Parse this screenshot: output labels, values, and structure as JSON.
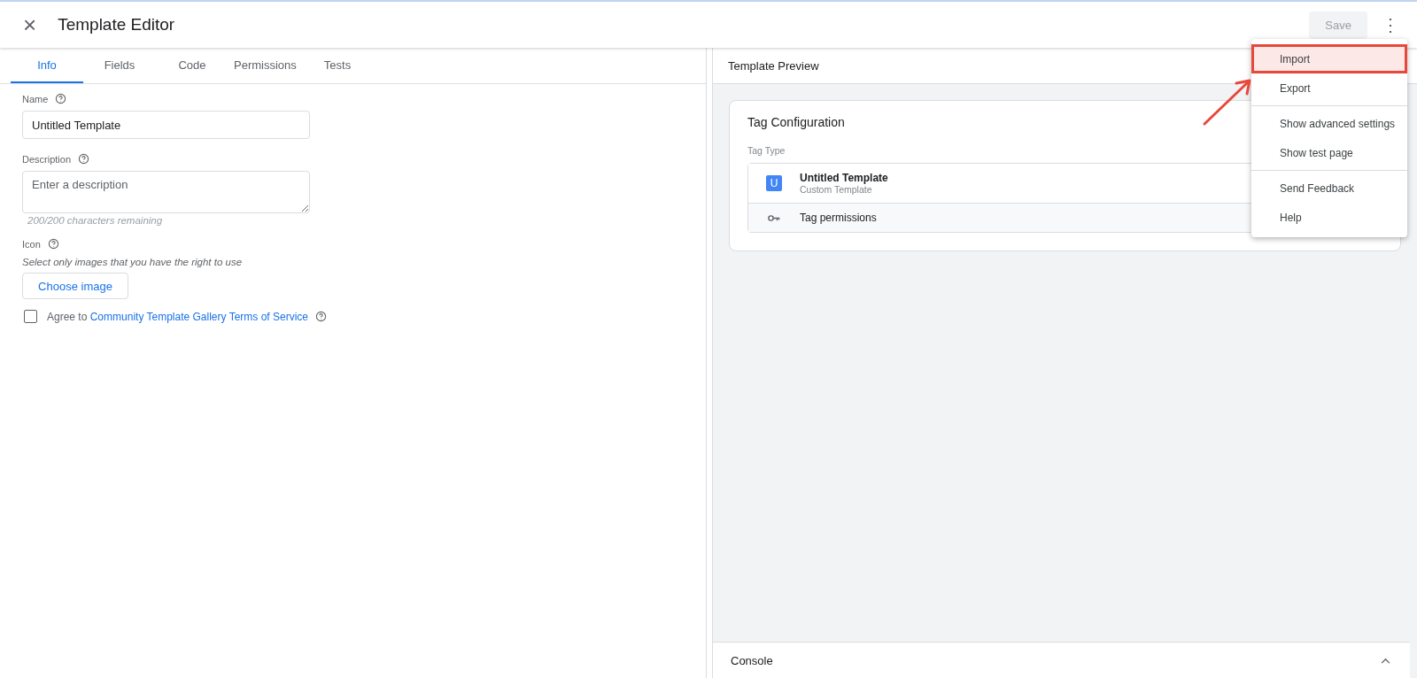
{
  "header": {
    "close": "×",
    "title": "Template Editor",
    "save": {
      "label": "Save",
      "disabled": true
    },
    "more": "⋮"
  },
  "tabs": [
    {
      "label": "Info",
      "selected": true
    },
    {
      "label": "Fields",
      "selected": false
    },
    {
      "label": "Code",
      "selected": false
    },
    {
      "label": "Permissions",
      "selected": false
    },
    {
      "label": "Tests",
      "selected": false
    }
  ],
  "form": {
    "name": {
      "label": "Name",
      "value": "Untitled Template"
    },
    "description": {
      "label": "Description",
      "placeholder": "Enter a description",
      "helper": "200/200 characters remaining"
    },
    "icon": {
      "label": "Icon",
      "note": "Select only images that you have the right to use",
      "button": "Choose image"
    },
    "agree": {
      "checked": false,
      "prefix": "Agree to",
      "link": "Community Template Gallery Terms of Service"
    }
  },
  "preview": {
    "title": "Template Preview",
    "card_title": "Tag Configuration",
    "tag_type_label": "Tag Type",
    "tag_icon": "U",
    "tag_name": "Untitled Template",
    "tag_subtitle": "Custom Template",
    "permissions": "Tag permissions"
  },
  "console": {
    "label": "Console",
    "expanded": false
  },
  "menu": [
    {
      "label": "Import",
      "divider_before": false,
      "highlighted": true
    },
    {
      "label": "Export",
      "divider_before": false,
      "highlighted": false
    },
    {
      "label": "Show advanced settings",
      "divider_before": true,
      "highlighted": false
    },
    {
      "label": "Show test page",
      "divider_before": false,
      "highlighted": false
    },
    {
      "label": "Send Feedback",
      "divider_before": true,
      "highlighted": false
    },
    {
      "label": "Help",
      "divider_before": false,
      "highlighted": false
    }
  ]
}
